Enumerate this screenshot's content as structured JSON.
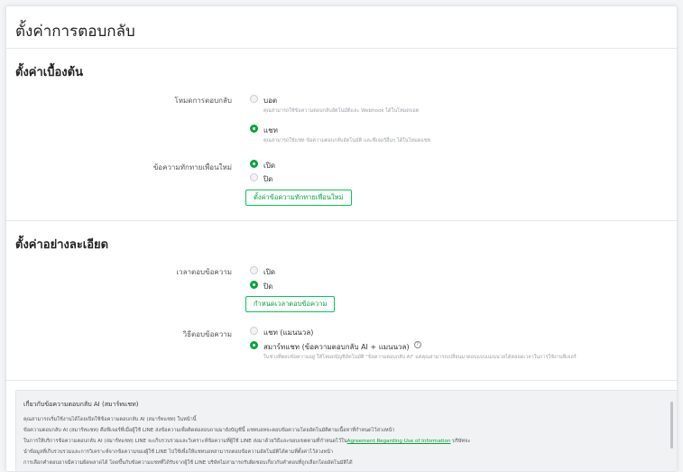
{
  "header": {
    "title": "ตั้งค่าการตอบกลับ"
  },
  "basic": {
    "title": "ตั้งค่าเบื้องต้น",
    "response_mode": {
      "label": "โหมดการตอบกลับ",
      "options": [
        {
          "label": "บอต",
          "desc": "คุณสามารถใช้ข้อความตอบกลับอัตโนมัติและ Webhook ได้ในโหมดบอต",
          "selected": false
        },
        {
          "label": "แชท",
          "desc": "คุณสามารถใช้แชท ข้อความตอบกลับอัตโนมัติ และฟีเจอร์อื่นๆ ได้ในโหมดแชท",
          "selected": true
        }
      ]
    },
    "greeting": {
      "label": "ข้อความทักทายเพื่อนใหม่",
      "options": [
        {
          "label": "เปิด",
          "selected": true
        },
        {
          "label": "ปิด",
          "selected": false
        }
      ],
      "button": "ตั้งค่าข้อความทักทายเพื่อนใหม่"
    }
  },
  "advanced": {
    "title": "ตั้งค่าอย่างละเอียด",
    "response_time": {
      "label": "เวลาตอบข้อความ",
      "options": [
        {
          "label": "เปิด",
          "selected": false
        },
        {
          "label": "ปิด",
          "selected": true
        }
      ],
      "button": "กำหนดเวลาตอบข้อความ"
    },
    "response_method": {
      "label": "วิธีตอบข้อความ",
      "options": [
        {
          "label": "แชท (แมนนวล)",
          "selected": false
        },
        {
          "label": "สมาร์ทแชท (ข้อความตอบกลับ AI + แมนนวล)",
          "desc": "ในช่วงที่ตอบข้อความอยู่ ให้โหมดบัญชีอัตโนมัติ \"ข้อความตอบกลับ AI\" แต่คุณสามารถเปลี่ยนมาตอบแบบแมนนวลได้ตลอดเวลาในการใช้งานฟีเจอร์",
          "selected": true
        }
      ]
    }
  },
  "info": {
    "title": "เกี่ยวกับข้อความตอบกลับ AI (สมาร์ทแชท)",
    "lines": [
      "คุณสามารถเริ่มใช้งานได้โดยเปิดใช้ข้อความตอบกลับ AI (สมาร์ทแชท) ในหน้านี้",
      "ข้อความตอบกลับ AI (สมาร์ทแชท) คือฟีเจอร์ที่เมื่อผู้ใช้ LINE ส่งข้อความเพื่อติดต่อสอบถามมายังบัญชีนี้ แชทบอทจะตอบข้อความโดยอัตโนมัติตามเนื้อหาที่กำหนดไว้ล่วงหน้า",
      "ในการให้บริการข้อความตอบกลับ AI (สมาร์ทแชท) LINE จะเก็บรวบรวมและวิเคราะห์ข้อความที่ผู้ใช้ LINE ส่งมาด้วยวิธีและขอบเขตตามที่กำหนดไว้ใน",
      "นำข้อมูลที่เก็บรวบรวมและการวิเคราะห์จากข้อความของผู้ใช้ LINE ไปใช้เพื่อให้แชทบอทสามารถตอบข้อความอัตโนมัติได้ตามที่ตั้งค่าไว้ล่วงหน้า",
      "การเลือกคำตอบอาจมีความผิดพลาดได้ โดยขึ้นกับข้อความแชทที่ได้รับจากผู้ใช้ LINE บริษัทไม่สามารถรับผิดชอบเกี่ยวกับคำตอบที่ถูกเลือกโดยอัตโนมัติได้"
    ],
    "link_text": "Agreement Regarding Use of Information",
    "link_suffix": " บริษัทจะ"
  },
  "colors": {
    "accent": "#06c755",
    "accent_text": "#06a43c"
  }
}
